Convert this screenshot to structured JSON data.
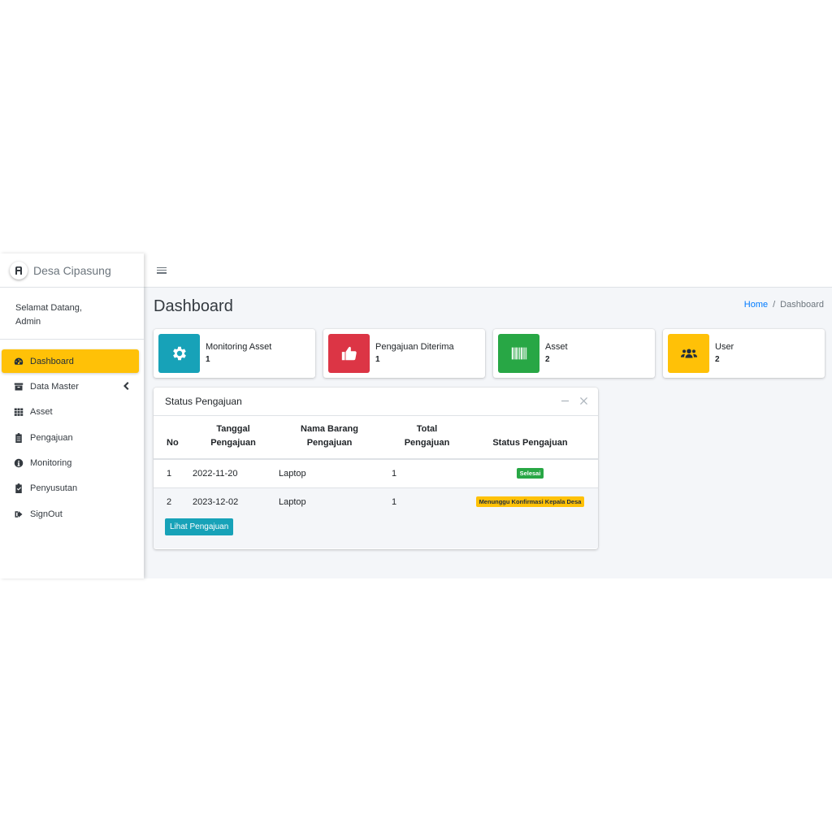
{
  "brand": {
    "name": "Desa Cipasung"
  },
  "user_panel": {
    "greeting": "Selamat Datang,",
    "name": "Admin"
  },
  "sidebar": {
    "items": [
      {
        "label": "Dashboard",
        "icon": "tachometer-icon",
        "active": true
      },
      {
        "label": "Data Master",
        "icon": "archive-icon",
        "has_submenu": true
      },
      {
        "label": "Asset",
        "icon": "grid-icon"
      },
      {
        "label": "Pengajuan",
        "icon": "clipboard-list-icon"
      },
      {
        "label": "Monitoring",
        "icon": "info-circle-icon"
      },
      {
        "label": "Penyusutan",
        "icon": "clipboard-check-icon"
      },
      {
        "label": "SignOut",
        "icon": "sign-out-icon"
      }
    ]
  },
  "header": {
    "title": "Dashboard",
    "breadcrumb": {
      "home": "Home",
      "current": "Dashboard"
    }
  },
  "info_boxes": [
    {
      "label": "Monitoring Asset",
      "value": "1",
      "color": "#17a2b8",
      "icon": "gear-icon"
    },
    {
      "label": "Pengajuan Diterima",
      "value": "1",
      "color": "#dc3545",
      "icon": "thumbs-up-icon"
    },
    {
      "label": "Asset",
      "value": "2",
      "color": "#28a745",
      "icon": "barcode-icon"
    },
    {
      "label": "User",
      "value": "2",
      "color": "#ffc107",
      "icon": "users-icon"
    }
  ],
  "status_card": {
    "title": "Status Pengajuan",
    "columns": {
      "no": "No",
      "tanggal_1": "Tanggal",
      "tanggal_2": "Pengajuan",
      "nama_1": "Nama Barang",
      "nama_2": "Pengajuan",
      "total_1": "Total",
      "total_2": "Pengajuan",
      "status": "Status Pengajuan"
    },
    "rows": [
      {
        "no": "1",
        "tanggal": "2022-11-20",
        "nama": "Laptop",
        "total": "1",
        "status": "Selesai",
        "status_color": "#28a745"
      },
      {
        "no": "2",
        "tanggal": "2023-12-02",
        "nama": "Laptop",
        "total": "1",
        "status": "Menunggu Konfirmasi Kepala Desa",
        "status_color": "#ffc107"
      }
    ],
    "button": "Lihat Pengajuan"
  }
}
